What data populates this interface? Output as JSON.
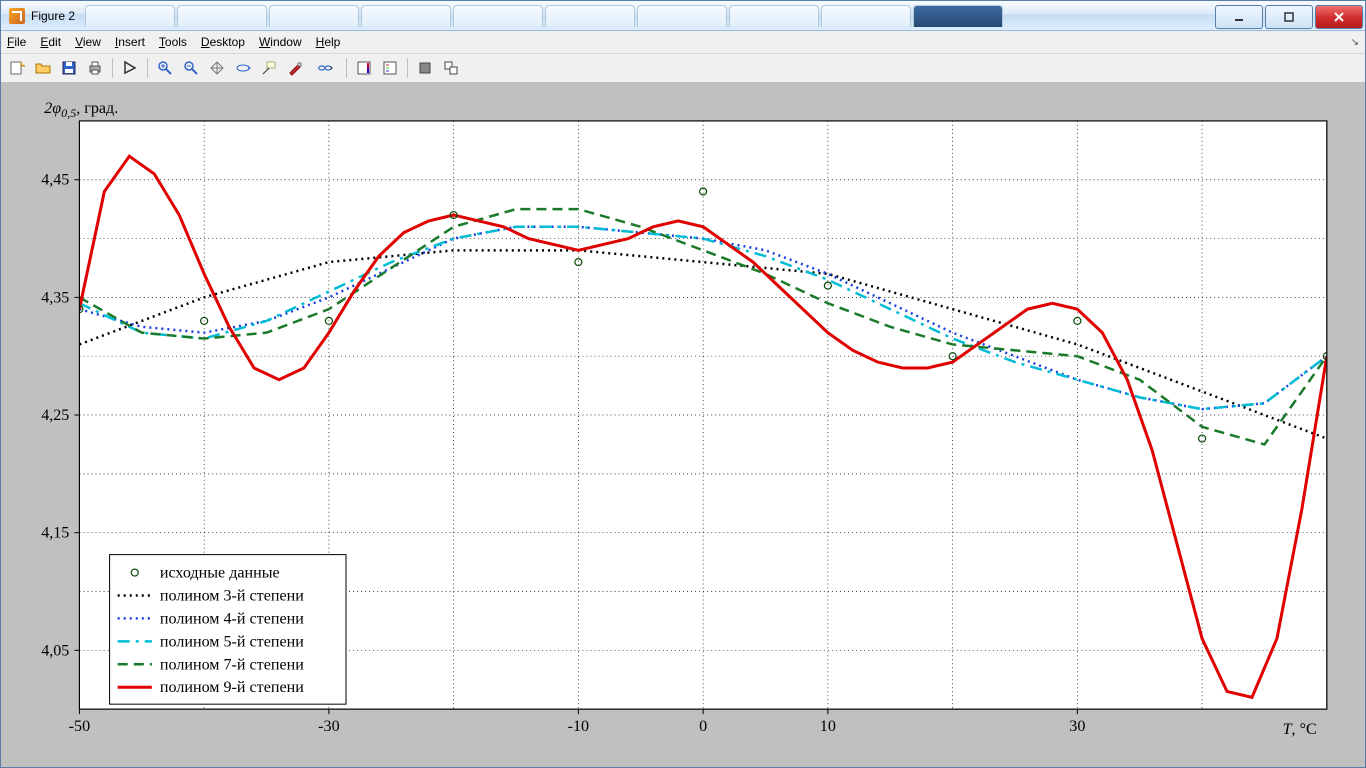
{
  "window": {
    "title": "Figure 2"
  },
  "tabs": [
    "",
    "",
    "",
    "",
    "",
    "",
    "",
    "",
    "",
    ""
  ],
  "menu": [
    "File",
    "Edit",
    "View",
    "Insert",
    "Tools",
    "Desktop",
    "Window",
    "Help"
  ],
  "chart_data": {
    "type": "line",
    "xlabel": "T, °C",
    "ylabel": "2φ₀,₅, град.",
    "xlim": [
      -50,
      50
    ],
    "ylim": [
      4.0,
      4.5
    ],
    "xticks": [
      -50,
      -30,
      -10,
      0,
      10,
      30
    ],
    "yticks": [
      4.05,
      4.15,
      4.25,
      4.35,
      4.45
    ],
    "xtick_labels": [
      "-50",
      "-30",
      "-10",
      "0",
      "10",
      "30"
    ],
    "ytick_labels": [
      "4,05",
      "4,15",
      "4,25",
      "4,35",
      "4,45"
    ],
    "markers": {
      "name": "исходные данные",
      "x": [
        -50,
        -40,
        -30,
        -20,
        -10,
        0,
        10,
        20,
        30,
        40,
        50
      ],
      "y": [
        4.34,
        4.33,
        4.33,
        4.42,
        4.38,
        4.44,
        4.36,
        4.3,
        4.33,
        4.23,
        4.3
      ]
    },
    "series": [
      {
        "name": "полином 3-й степени",
        "style": "dot",
        "color": "#000",
        "x": [
          -50,
          -40,
          -30,
          -20,
          -10,
          0,
          10,
          20,
          30,
          40,
          50
        ],
        "y": [
          4.31,
          4.35,
          4.38,
          4.39,
          4.39,
          4.38,
          4.37,
          4.34,
          4.31,
          4.27,
          4.23
        ]
      },
      {
        "name": "полином 4-й степени",
        "style": "dot",
        "color": "#1a3fe0",
        "x": [
          -50,
          -45,
          -40,
          -35,
          -30,
          -25,
          -20,
          -15,
          -10,
          -5,
          0,
          5,
          10,
          15,
          20,
          25,
          30,
          35,
          40,
          45,
          50
        ],
        "y": [
          4.34,
          4.325,
          4.32,
          4.33,
          4.35,
          4.375,
          4.4,
          4.41,
          4.41,
          4.405,
          4.4,
          4.39,
          4.37,
          4.345,
          4.32,
          4.3,
          4.28,
          4.265,
          4.255,
          4.26,
          4.3
        ]
      },
      {
        "name": "полином 5-й степени",
        "style": "dashdot",
        "color": "#00bcd4",
        "x": [
          -50,
          -45,
          -40,
          -35,
          -30,
          -25,
          -20,
          -15,
          -10,
          -5,
          0,
          5,
          10,
          15,
          20,
          25,
          30,
          35,
          40,
          45,
          50
        ],
        "y": [
          4.345,
          4.32,
          4.315,
          4.33,
          4.355,
          4.38,
          4.4,
          4.41,
          4.41,
          4.405,
          4.4,
          4.385,
          4.365,
          4.34,
          4.315,
          4.295,
          4.28,
          4.265,
          4.255,
          4.26,
          4.3
        ]
      },
      {
        "name": "полином 7-й степени",
        "style": "dash",
        "color": "#1b7a2a",
        "x": [
          -50,
          -45,
          -40,
          -35,
          -30,
          -25,
          -20,
          -15,
          -10,
          -5,
          0,
          5,
          10,
          15,
          20,
          25,
          30,
          35,
          40,
          45,
          50
        ],
        "y": [
          4.35,
          4.32,
          4.315,
          4.32,
          4.34,
          4.375,
          4.41,
          4.425,
          4.425,
          4.41,
          4.39,
          4.37,
          4.345,
          4.325,
          4.31,
          4.305,
          4.3,
          4.28,
          4.24,
          4.225,
          4.3
        ]
      },
      {
        "name": "полином 9-й степени",
        "style": "solid",
        "color": "#e00000",
        "x": [
          -50,
          -48,
          -46,
          -44,
          -42,
          -40,
          -38,
          -36,
          -34,
          -32,
          -30,
          -28,
          -26,
          -24,
          -22,
          -20,
          -18,
          -16,
          -14,
          -12,
          -10,
          -8,
          -6,
          -4,
          -2,
          0,
          2,
          4,
          6,
          8,
          10,
          12,
          14,
          16,
          18,
          20,
          22,
          24,
          26,
          28,
          30,
          32,
          34,
          36,
          38,
          40,
          42,
          44,
          46,
          48,
          50
        ],
        "y": [
          4.34,
          4.44,
          4.47,
          4.455,
          4.42,
          4.37,
          4.325,
          4.29,
          4.28,
          4.29,
          4.32,
          4.355,
          4.385,
          4.405,
          4.415,
          4.42,
          4.415,
          4.41,
          4.4,
          4.395,
          4.39,
          4.395,
          4.4,
          4.41,
          4.415,
          4.41,
          4.395,
          4.38,
          4.36,
          4.34,
          4.32,
          4.305,
          4.295,
          4.29,
          4.29,
          4.295,
          4.31,
          4.325,
          4.34,
          4.345,
          4.34,
          4.32,
          4.28,
          4.22,
          4.14,
          4.06,
          4.015,
          4.01,
          4.06,
          4.17,
          4.3
        ]
      }
    ],
    "legend_labels": [
      "исходные данные",
      "полином 3-й степени",
      "полином 4-й степени",
      "полином 5-й степени",
      "полином 7-й степени",
      "полином 9-й степени"
    ]
  },
  "toolbar_items": [
    "new",
    "open",
    "save",
    "print",
    "arrow",
    "zoom-in",
    "zoom-out",
    "pan",
    "rotate",
    "data-cursor",
    "brush",
    "link",
    "insert-colorbar",
    "insert-legend",
    "hide-plot",
    "show-plot"
  ]
}
